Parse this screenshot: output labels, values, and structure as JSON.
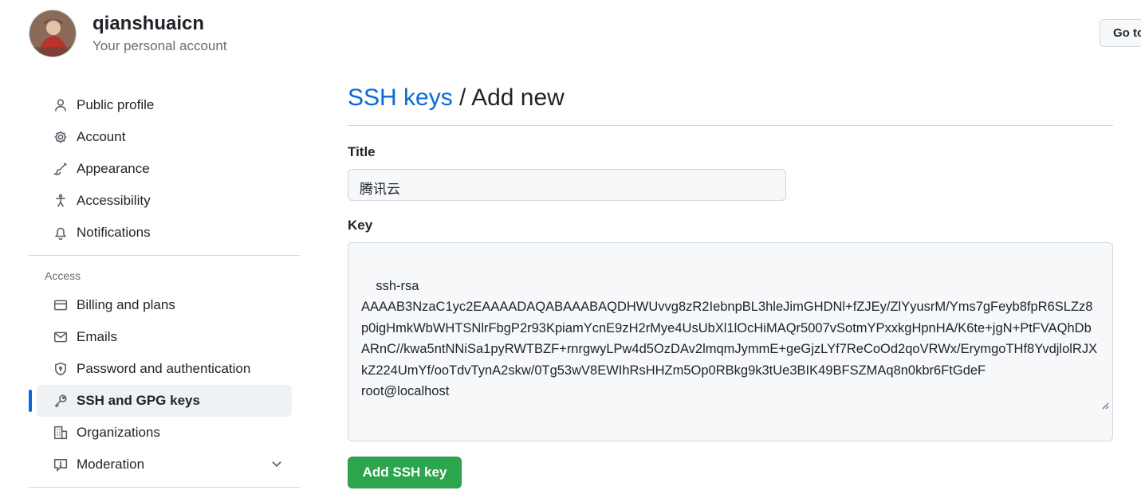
{
  "header": {
    "username": "qianshuaicn",
    "subtitle": "Your personal account",
    "goto_button": "Go to"
  },
  "sidebar": {
    "items": [
      {
        "label": "Public profile",
        "icon": "person-icon"
      },
      {
        "label": "Account",
        "icon": "gear-icon"
      },
      {
        "label": "Appearance",
        "icon": "paintbrush-icon"
      },
      {
        "label": "Accessibility",
        "icon": "accessibility-icon"
      },
      {
        "label": "Notifications",
        "icon": "bell-icon"
      }
    ],
    "access_heading": "Access",
    "access_items": [
      {
        "label": "Billing and plans",
        "icon": "credit-card-icon"
      },
      {
        "label": "Emails",
        "icon": "mail-icon"
      },
      {
        "label": "Password and authentication",
        "icon": "shield-lock-icon"
      },
      {
        "label": "SSH and GPG keys",
        "icon": "key-icon",
        "active": true
      },
      {
        "label": "Organizations",
        "icon": "organization-icon"
      },
      {
        "label": "Moderation",
        "icon": "report-icon"
      }
    ]
  },
  "main": {
    "breadcrumb_link": "SSH keys",
    "separator": " / ",
    "title": "Add new",
    "title_label": "Title",
    "title_value": "腾讯云",
    "key_label": "Key",
    "key_value": "ssh-rsa\nAAAAB3NzaC1yc2EAAAADAQABAAABAQDHWUvvg8zR2IebnpBL3hleJimGHDNl+fZJEy/ZlYyusrM/Yms7gFeyb8fpR6SLZz8p0igHmkWbWHTSNlrFbgP2r93KpiamYcnE9zH2rMye4UsUbXl1lOcHiMAQr5007vSotmYPxxkgHpnHA/K6te+jgN+PtFVAQhDbARnC//kwa5ntNNiSa1pyRWTBZF+rnrgwyLPw4d5OzDAv2lmqmJymmE+geGjzLYf7ReCoOd2qoVRWx/ErymgoTHf8YvdjlolRJXkZ224UmYf/ooTdvTynA2skw/0Tg53wV8EWIhRsHHZm5Op0RBkg9k3tUe3BIK49BFSZMAq8n0kbr6FtGdeF\nroot@localhost",
    "submit_label": "Add SSH key"
  },
  "colors": {
    "link": "#0969da",
    "primary_button": "#2da44e",
    "active_indicator": "#0969da"
  }
}
